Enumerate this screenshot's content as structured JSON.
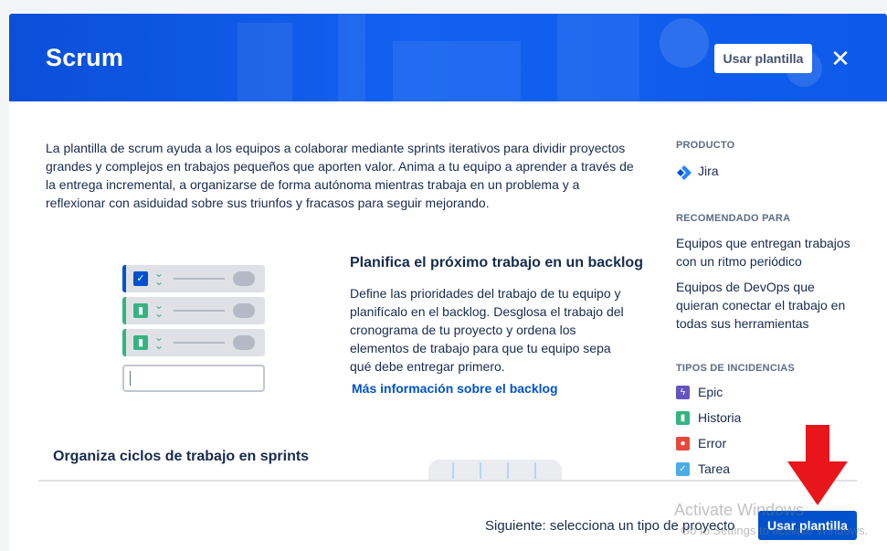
{
  "header": {
    "title": "Scrum",
    "use_template_label": "Usar plantilla",
    "close_glyph": "✕"
  },
  "main": {
    "intro": "La plantilla de scrum ayuda a los equipos a colaborar mediante sprints iterativos para dividir proyectos grandes y complejos en trabajos pequeños que aporten valor. Anima a tu equipo a aprender a través de la entrega incremental, a organizarse de forma autónoma mientras trabaja en un problema y a reflexionar con asiduidad sobre sus triunfos y fracasos para seguir mejorando.",
    "backlog": {
      "title": "Planifica el próximo trabajo en un backlog",
      "body": "Define las prioridades del trabajo de tu equipo y planifícalo en el backlog. Desglosa el trabajo del cronograma de tu proyecto y ordena los elementos de trabajo para que tu equipo sepa qué debe entregar primero.",
      "link": "Más información sobre el backlog"
    },
    "sprints_title": "Organiza ciclos de trabajo en sprints"
  },
  "sidebar": {
    "product_heading": "PRODUCTO",
    "product_name": "Jira",
    "recommended_heading": "RECOMENDADO PARA",
    "recommended": [
      "Equipos que entregan trabajos con un ritmo periódico",
      "Equipos de DevOps que quieran conectar el trabajo en todas sus herramientas"
    ],
    "issue_types_heading": "TIPOS DE INCIDENCIAS",
    "issue_types": [
      {
        "label": "Epic",
        "icon": "lightning-icon",
        "color": "#6554c0"
      },
      {
        "label": "Historia",
        "icon": "bookmark-icon",
        "color": "#36b37e"
      },
      {
        "label": "Error",
        "icon": "bug-icon",
        "color": "#e5493a"
      },
      {
        "label": "Tarea",
        "icon": "check-icon",
        "color": "#4bade8"
      }
    ]
  },
  "footer": {
    "next_text": "Siguiente: selecciona un tipo de proyecto",
    "use_template_label": "Usar plantilla"
  },
  "watermark": {
    "line1": "Activate Windows",
    "line2": "Go to Settings to activate Windows."
  },
  "colors": {
    "primary": "#0052cc",
    "header": "#0d5ae9",
    "annotation_arrow": "#e8161b"
  }
}
